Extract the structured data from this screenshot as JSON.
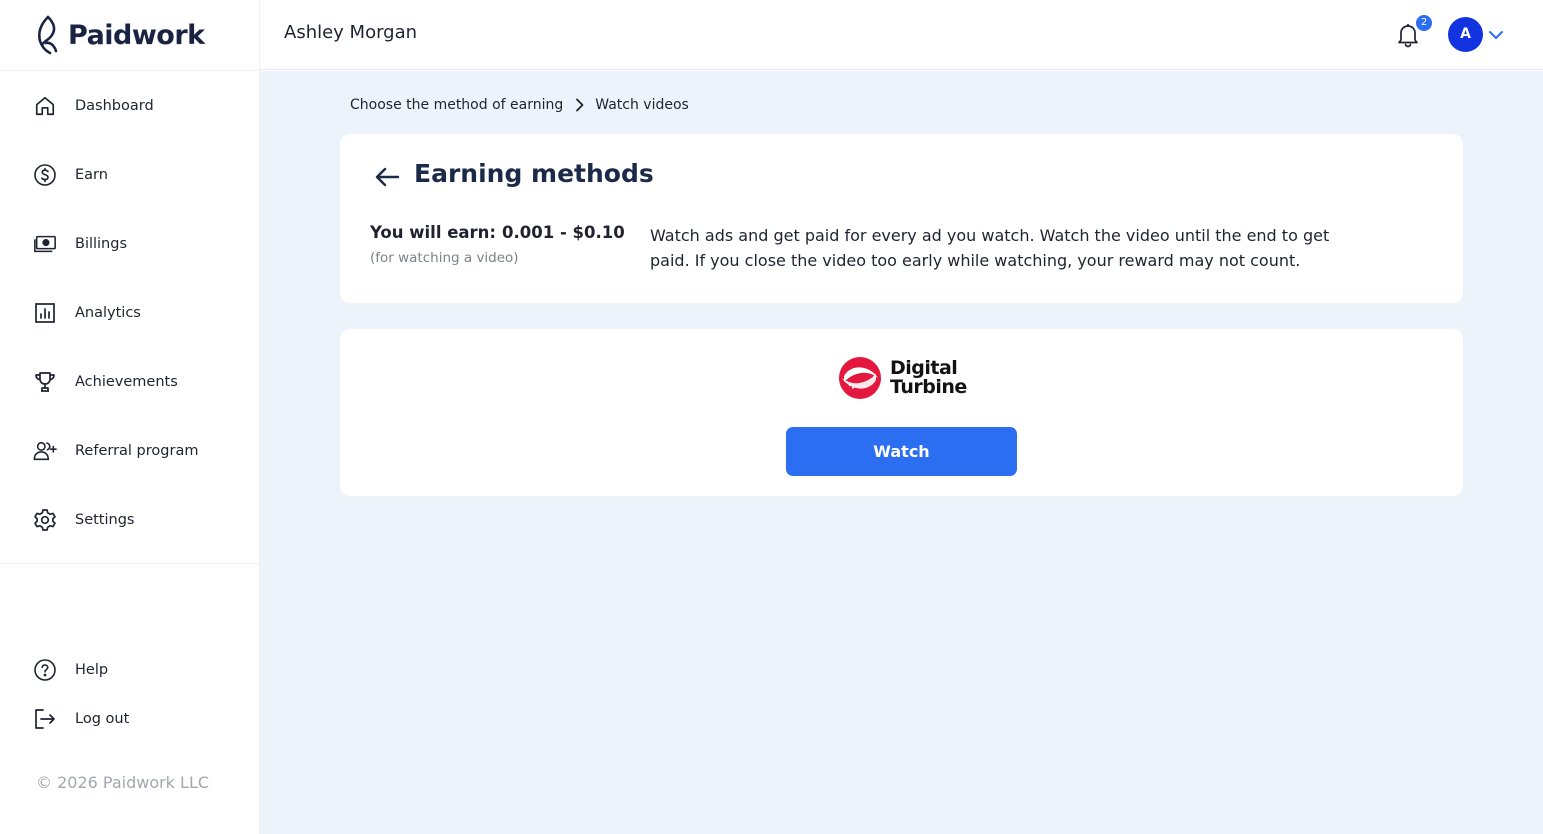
{
  "brand": {
    "name": "Paidwork"
  },
  "sidebar": {
    "items": [
      {
        "label": "Dashboard",
        "icon": "home-icon"
      },
      {
        "label": "Earn",
        "icon": "dollar-circle-icon"
      },
      {
        "label": "Billings",
        "icon": "cash-icon"
      },
      {
        "label": "Analytics",
        "icon": "bar-chart-icon"
      },
      {
        "label": "Achievements",
        "icon": "trophy-icon"
      },
      {
        "label": "Referral program",
        "icon": "add-user-icon"
      },
      {
        "label": "Settings",
        "icon": "gear-icon"
      }
    ],
    "bottom": [
      {
        "label": "Help",
        "icon": "help-icon"
      },
      {
        "label": "Log out",
        "icon": "logout-icon"
      }
    ],
    "copyright": "© 2026 Paidwork LLC"
  },
  "header": {
    "username": "Ashley Morgan",
    "notifications": "2",
    "avatar_initial": "A"
  },
  "breadcrumb": {
    "items": [
      "Choose the method of earning",
      "Watch videos"
    ]
  },
  "earning": {
    "title": "Earning methods",
    "earn_label": "You will earn:",
    "earn_amount": "0.001 - $0.10",
    "earn_sub": "(for watching a video)",
    "description": "Watch ads and get paid for every ad you watch. Watch the video until the end to get paid. If you close the video too early while watching, your reward may not count."
  },
  "provider": {
    "name_line1": "Digital",
    "name_line2": "Turbine",
    "button_label": "Watch"
  },
  "colors": {
    "accent": "#2b6ef2",
    "avatar": "#1133e0",
    "background": "#edf3fb",
    "provider_logo": "#e4173e"
  }
}
